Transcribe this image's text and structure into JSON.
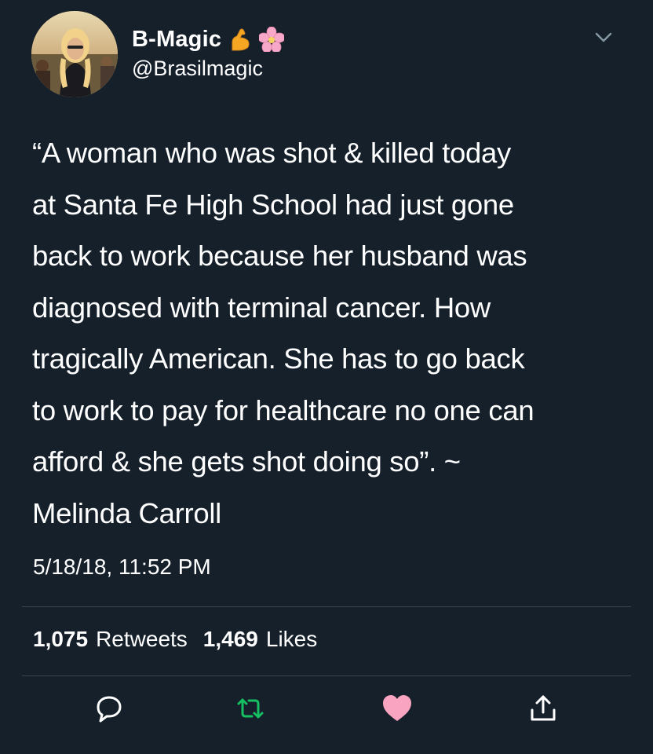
{
  "user": {
    "display_name": "B-Magic",
    "handle": "@Brasilmagic",
    "badges": [
      "flexed-biceps-icon",
      "cherry-blossom-icon"
    ]
  },
  "tweet": {
    "text": "“A woman who was shot & killed today\nat Santa Fe High School had just gone\nback to work because her husband was\ndiagnosed with terminal cancer. How\ntragically American. She has to go back\nto work to pay for healthcare no one can\nafford & she gets shot doing so”. ~\nMelinda Carroll",
    "timestamp": "5/18/18, 11:52 PM"
  },
  "stats": {
    "retweets_count": "1,075",
    "retweets_label": "Retweets",
    "likes_count": "1,469",
    "likes_label": "Likes"
  },
  "actions": [
    "reply-icon",
    "retweet-icon",
    "like-icon",
    "share-icon"
  ],
  "colors": {
    "background": "#15202b",
    "divider": "#38444d",
    "retweet": "#17bf63",
    "like": "#f9a4c0",
    "icon": "#8899a6",
    "emoji_biceps": "#f5a623",
    "emoji_blossom": "#f7a8c8"
  }
}
